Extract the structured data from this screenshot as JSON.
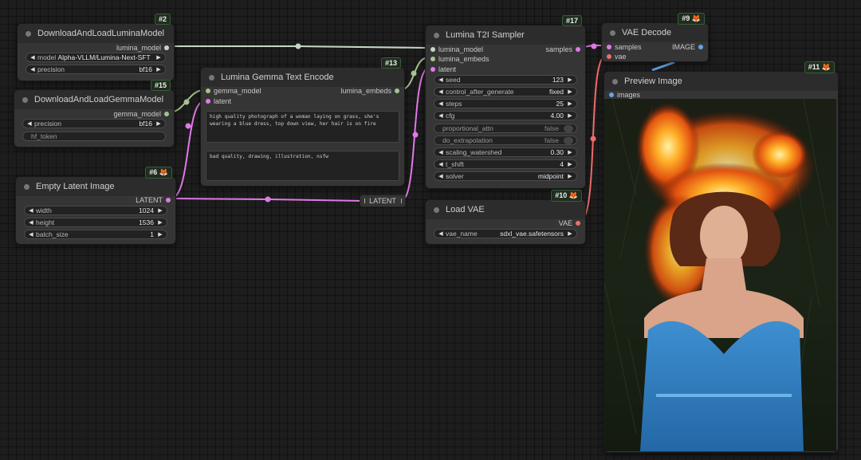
{
  "colors": {
    "lumina_wire": "#c5d7c5",
    "gemma_wire": "#a6c28d",
    "latent_wire": "#e07ae8",
    "vae_wire": "#f16c6c",
    "image_wire": "#63a6e8",
    "embeds_wire": "#a6c28d"
  },
  "nodes": {
    "lumina_loader": {
      "id": "#2",
      "title": "DownloadAndLoadLuminaModel",
      "output": "lumina_model",
      "widgets": [
        {
          "label": "model",
          "value": "Alpha-VLLM/Lumina-Next-SFT"
        },
        {
          "label": "precision",
          "value": "bf16"
        }
      ]
    },
    "gemma_loader": {
      "id": "#15",
      "title": "DownloadAndLoadGemmaModel",
      "output": "gemma_model",
      "widgets": [
        {
          "label": "precision",
          "value": "bf16"
        }
      ],
      "token_label": "hf_token"
    },
    "empty_latent": {
      "id": "#6",
      "title": "Empty Latent Image",
      "output": "LATENT",
      "widgets": [
        {
          "label": "width",
          "value": "1024"
        },
        {
          "label": "height",
          "value": "1536"
        },
        {
          "label": "batch_size",
          "value": "1"
        }
      ]
    },
    "text_encode": {
      "id": "#13",
      "title": "Lumina Gemma Text Encode",
      "inputs": [
        "gemma_model",
        "latent"
      ],
      "output": "lumina_embeds",
      "positive": "high quality photograph of a woman laying on grass, she's wearing a blue dress, top down view, her hair is on fire",
      "negative": "bad quality, drawing, illustration, nsfw"
    },
    "sampler": {
      "id": "#17",
      "title": "Lumina T2I Sampler",
      "inputs": [
        "lumina_model",
        "lumina_embeds",
        "latent"
      ],
      "output": "samples",
      "widgets": [
        {
          "label": "seed",
          "value": "123"
        },
        {
          "label": "control_after_generate",
          "value": "fixed"
        },
        {
          "label": "steps",
          "value": "25"
        },
        {
          "label": "cfg",
          "value": "4.00"
        },
        {
          "label": "proportional_attn",
          "value": "false",
          "toggle": true
        },
        {
          "label": "do_extrapolation",
          "value": "false",
          "toggle": true
        },
        {
          "label": "scaling_watershed",
          "value": "0.30"
        },
        {
          "label": "t_shift",
          "value": "4"
        },
        {
          "label": "solver",
          "value": "midpoint"
        }
      ]
    },
    "load_vae": {
      "id": "#10",
      "title": "Load VAE",
      "output": "VAE",
      "widgets": [
        {
          "label": "vae_name",
          "value": "sdxl_vae.safetensors"
        }
      ]
    },
    "vae_decode": {
      "id": "#9",
      "title": "VAE Decode",
      "inputs": [
        "samples",
        "vae"
      ],
      "output": "IMAGE"
    },
    "preview": {
      "id": "#11",
      "title": "Preview Image",
      "input": "images"
    }
  },
  "reroute": {
    "label": "LATENT"
  },
  "icons": {
    "badge_icon": "fox-icon",
    "arrow_left": "◀",
    "arrow_right": "▶"
  }
}
